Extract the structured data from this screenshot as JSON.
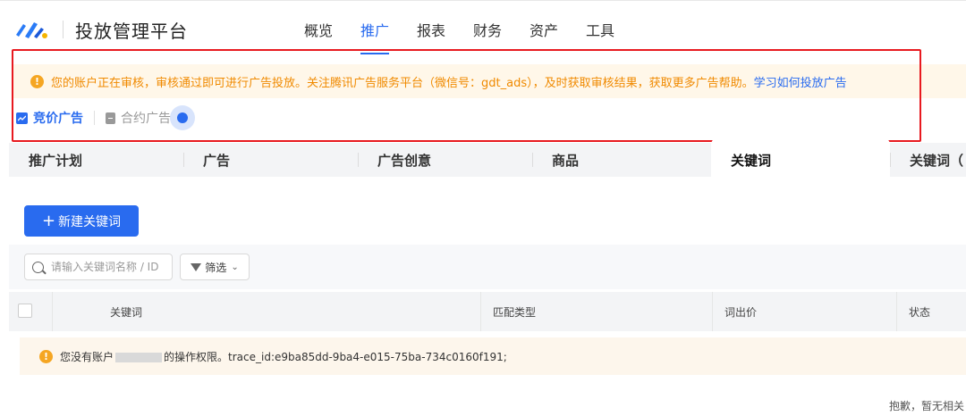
{
  "header": {
    "app_title": "投放管理平台",
    "nav": [
      "概览",
      "推广",
      "报表",
      "财务",
      "资产",
      "工具"
    ],
    "active_nav": "推广"
  },
  "notice": {
    "text": "您的账户正在审核，审核通过即可进行广告投放。关注腾讯广告服务平台（微信号：gdt_ads），及时获取审核结果，获取更多广告帮助。",
    "link": "学习如何投放广告"
  },
  "ad_types": [
    {
      "label": "竞价广告",
      "active": true,
      "icon": "chart-icon"
    },
    {
      "label": "合约广告",
      "active": false,
      "icon": "document-icon"
    }
  ],
  "tabs": [
    "推广计划",
    "广告",
    "广告创意",
    "商品",
    "关键词",
    "关键词（"
  ],
  "active_tab": "关键词",
  "toolbar": {
    "new_button": "新建关键词",
    "search_placeholder": "请输入关键词名称 / ID",
    "filter_label": "筛选"
  },
  "table": {
    "columns": [
      "关键词",
      "匹配类型",
      "词出价",
      "状态"
    ]
  },
  "error": {
    "prefix": "您没有账户",
    "suffix": "的操作权限。trace_id:e9ba85dd-9ba4-e015-75ba-734c0160f191;"
  },
  "empty_text": "抱歉，暂无相关",
  "colors": {
    "primary": "#296bef",
    "warning": "#f08a00",
    "highlight_border": "#e8191f",
    "notice_bg": "#fff7e9"
  }
}
